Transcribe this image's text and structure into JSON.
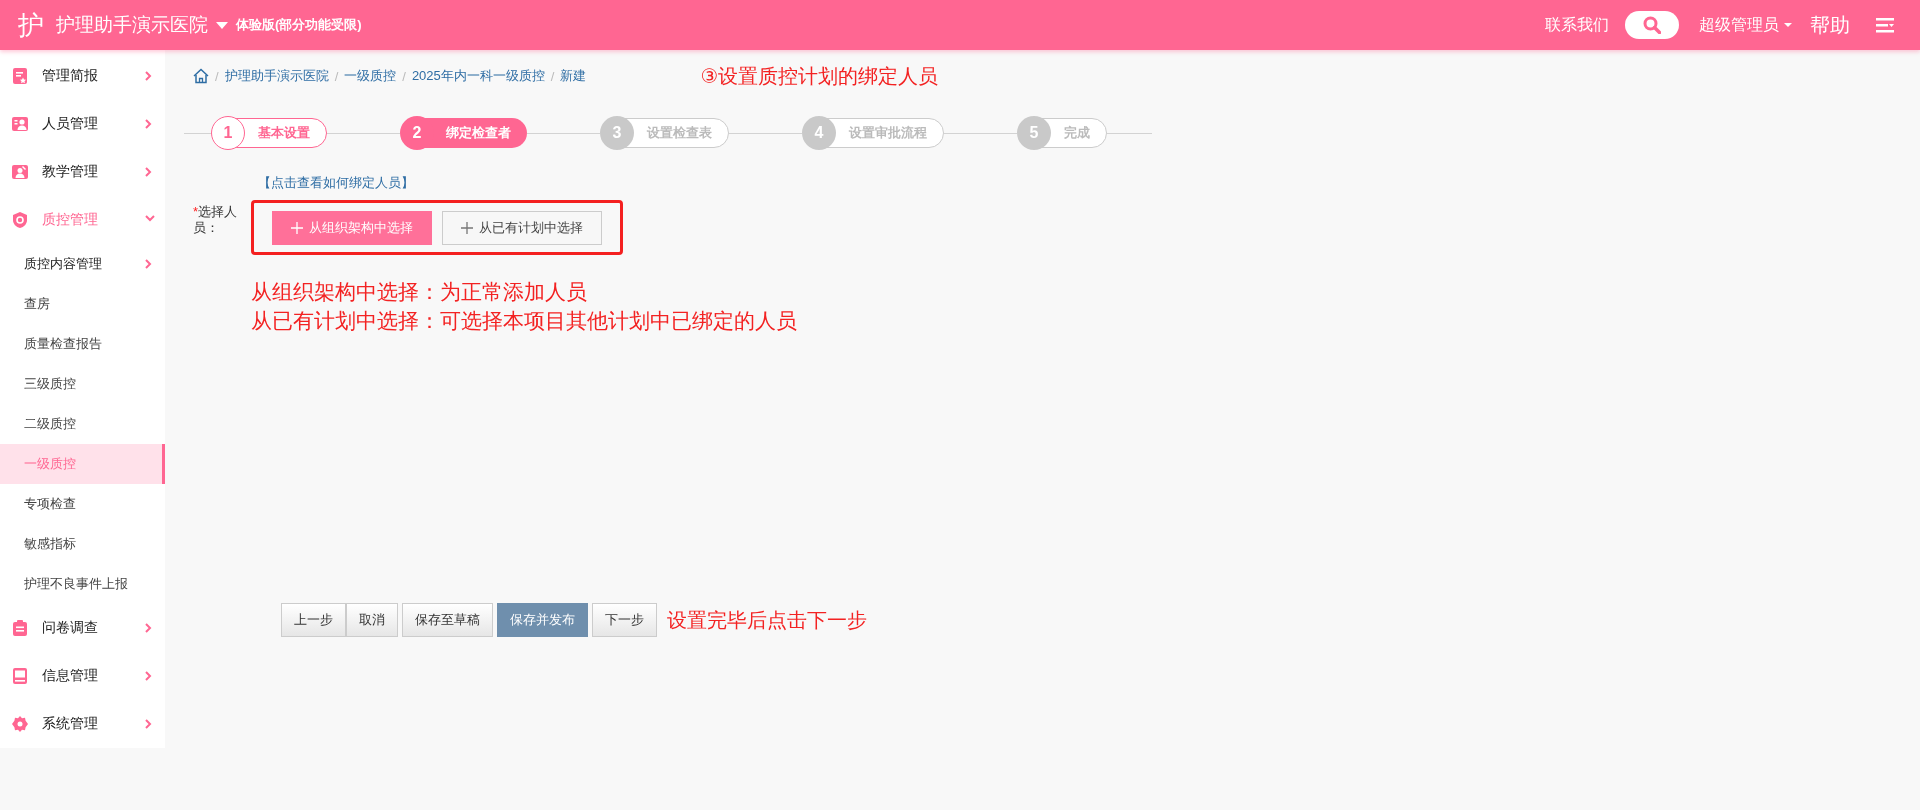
{
  "header": {
    "logo": "护",
    "title": "护理助手演示医院",
    "edition": "体验版(部分功能受限)",
    "contact": "联系我们",
    "user": "超级管理员",
    "help": "帮助"
  },
  "sidebar": {
    "items": [
      {
        "label": "管理简报",
        "expanded": false
      },
      {
        "label": "人员管理",
        "expanded": false
      },
      {
        "label": "教学管理",
        "expanded": false
      },
      {
        "label": "质控管理",
        "expanded": true,
        "children": [
          {
            "label": "质控内容管理",
            "kind": "group",
            "selected": false
          },
          {
            "label": "查房",
            "kind": "link",
            "selected": false
          },
          {
            "label": "质量检查报告",
            "kind": "link",
            "selected": false
          },
          {
            "label": "三级质控",
            "kind": "link",
            "selected": false
          },
          {
            "label": "二级质控",
            "kind": "link",
            "selected": false
          },
          {
            "label": "一级质控",
            "kind": "link",
            "selected": true
          },
          {
            "label": "专项检查",
            "kind": "link",
            "selected": false
          },
          {
            "label": "敏感指标",
            "kind": "link",
            "selected": false
          },
          {
            "label": "护理不良事件上报",
            "kind": "link",
            "selected": false
          }
        ]
      },
      {
        "label": "问卷调查",
        "expanded": false
      },
      {
        "label": "信息管理",
        "expanded": false
      },
      {
        "label": "系统管理",
        "expanded": false
      }
    ]
  },
  "breadcrumb": [
    {
      "separator": "/",
      "label": "护理助手演示医院"
    },
    {
      "separator": "/",
      "label": "一级质控"
    },
    {
      "separator": "/",
      "label": "2025年内一科一级质控"
    },
    {
      "separator": "/",
      "label": "新建"
    }
  ],
  "annotation_top": "③设置质控计划的绑定人员",
  "steps": [
    {
      "number": "1",
      "label": "基本设置",
      "kind": "done"
    },
    {
      "number": "2",
      "label": "绑定检查者",
      "kind": "active"
    },
    {
      "number": "3",
      "label": "设置检查表",
      "kind": "pending"
    },
    {
      "number": "4",
      "label": "设置审批流程",
      "kind": "pending"
    },
    {
      "number": "5",
      "label": "完成",
      "kind": "pending"
    }
  ],
  "form": {
    "help_link": "【点击查看如何绑定人员】",
    "required_mark": "*",
    "label": "选择人员：",
    "buttons": [
      {
        "label": "从组织架构中选择",
        "kind": "primary"
      },
      {
        "label": "从已有计划中选择",
        "kind": "default"
      }
    ]
  },
  "notes": [
    "从组织架构中选择：为正常添加人员",
    "从已有计划中选择：可选择本项目其他计划中已绑定的人员"
  ],
  "footer": {
    "buttons": [
      {
        "label": "上一步",
        "kind": "default"
      },
      {
        "label": "取消",
        "kind": "default"
      },
      {
        "label": "保存至草稿",
        "kind": "default"
      },
      {
        "label": "保存并发布",
        "kind": "primary"
      },
      {
        "label": "下一步",
        "kind": "default"
      }
    ],
    "note": "设置完毕后点击下一步"
  }
}
